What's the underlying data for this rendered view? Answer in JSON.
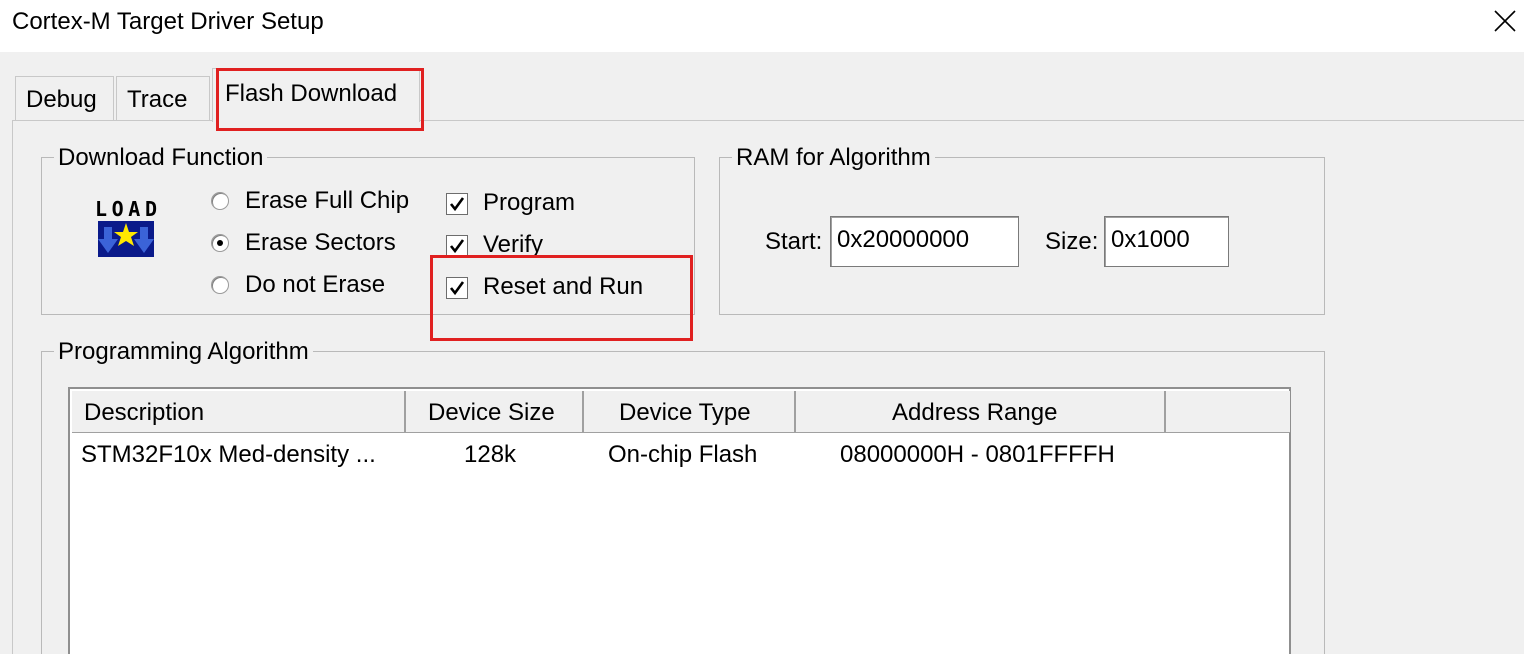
{
  "window": {
    "title": "Cortex-M Target Driver Setup",
    "close_icon": "close-icon"
  },
  "tabs": [
    {
      "label": "Debug",
      "selected": false
    },
    {
      "label": "Trace",
      "selected": false
    },
    {
      "label": "Flash Download",
      "selected": true
    }
  ],
  "download_function": {
    "title": "Download Function",
    "icon_label": "LOAD",
    "erase_options": [
      {
        "label": "Erase Full Chip",
        "checked": false
      },
      {
        "label": "Erase Sectors",
        "checked": true
      },
      {
        "label": "Do not Erase",
        "checked": false
      }
    ],
    "checkboxes": [
      {
        "label": "Program",
        "checked": true
      },
      {
        "label": "Verify",
        "checked": true
      },
      {
        "label": "Reset and Run",
        "checked": true
      }
    ]
  },
  "ram_for_algorithm": {
    "title": "RAM for Algorithm",
    "start_label": "Start:",
    "start_value": "0x20000000",
    "size_label": "Size:",
    "size_value": "0x1000"
  },
  "programming_algorithm": {
    "title": "Programming Algorithm",
    "columns": [
      "Description",
      "Device Size",
      "Device Type",
      "Address Range"
    ],
    "rows": [
      [
        "STM32F10x Med-density ...",
        "128k",
        "On-chip Flash",
        "08000000H - 0801FFFFH"
      ]
    ]
  },
  "annotation_colors": {
    "highlight": "#e02020"
  }
}
